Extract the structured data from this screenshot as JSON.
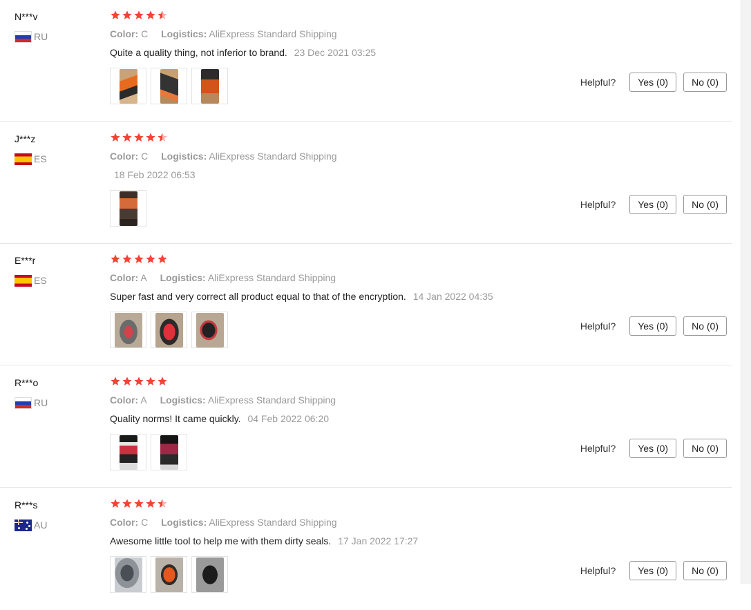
{
  "labels": {
    "color": "Color:",
    "logistics": "Logistics:",
    "helpful": "Helpful?"
  },
  "colors": {
    "star": "#f44336",
    "muted_text": "#999999",
    "divider": "#e6e6e6"
  },
  "reviews": [
    {
      "user": "N***v",
      "country": "RU",
      "flag": "ru-flag-icon",
      "rating": 4.5,
      "color": "C",
      "logistics": "AliExpress Standard Shipping",
      "text": "Quite a quality thing, not inferior to brand.",
      "date": "23 Dec 2021 03:25",
      "photos": 3,
      "yes": "Yes (0)",
      "no": "No (0)"
    },
    {
      "user": "J***z",
      "country": "ES",
      "flag": "es-flag-icon",
      "rating": 4.5,
      "color": "C",
      "logistics": "AliExpress Standard Shipping",
      "text": "",
      "date": "18 Feb 2022 06:53",
      "photos": 1,
      "yes": "Yes (0)",
      "no": "No (0)"
    },
    {
      "user": "E***r",
      "country": "ES",
      "flag": "es-flag-icon",
      "rating": 5,
      "color": "A",
      "logistics": "AliExpress Standard Shipping",
      "text": "Super fast and very correct all product equal to that of the encryption.",
      "date": "14 Jan 2022 04:35",
      "photos": 3,
      "yes": "Yes (0)",
      "no": "No (0)"
    },
    {
      "user": "R***o",
      "country": "RU",
      "flag": "ru-flag-icon",
      "rating": 5,
      "color": "A",
      "logistics": "AliExpress Standard Shipping",
      "text": "Quality norms! It came quickly.",
      "date": "04 Feb 2022 06:20",
      "photos": 2,
      "yes": "Yes (0)",
      "no": "No (0)"
    },
    {
      "user": "R***s",
      "country": "AU",
      "flag": "au-flag-icon",
      "rating": 4.5,
      "color": "C",
      "logistics": "AliExpress Standard Shipping",
      "text": "Awesome little tool to help me with them dirty seals.",
      "date": "17 Jan 2022 17:27",
      "photos": 3,
      "yes": "Yes (0)",
      "no": "No (0)"
    }
  ]
}
